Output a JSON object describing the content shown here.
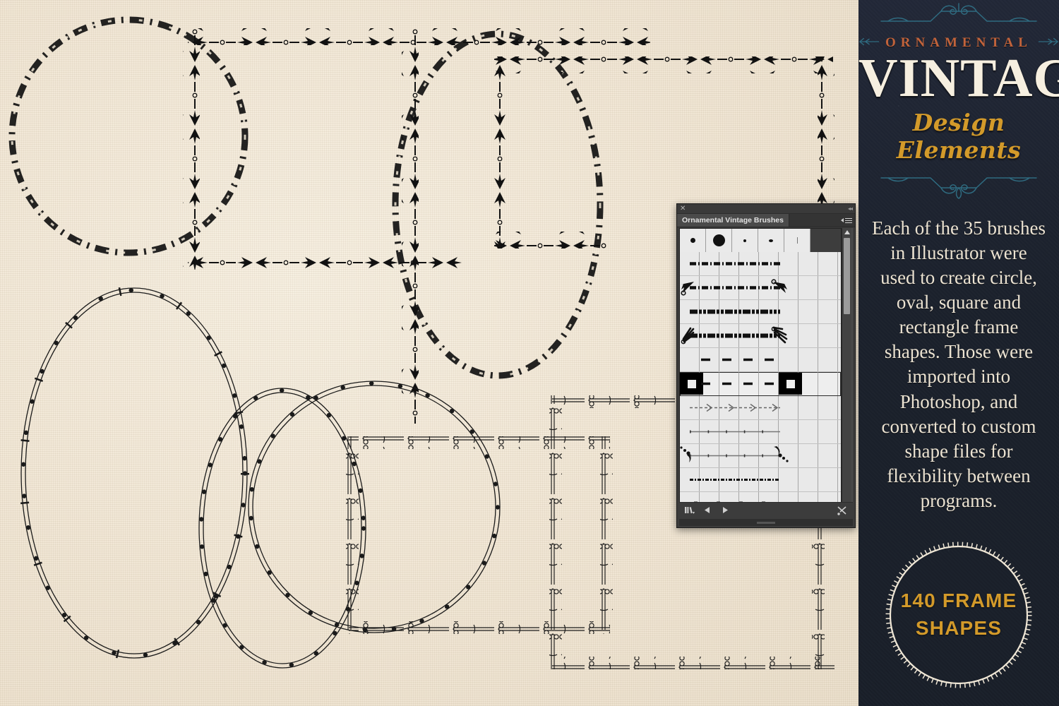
{
  "canvas": {
    "background_color": "#f1e7d6",
    "description": "Textured cream canvas with ornamental vintage frame shapes"
  },
  "brush_panel": {
    "title": "Ornamental Vintage Brushes",
    "close_label": "✕",
    "collapse_label": "◂◂",
    "menu_label": "≡",
    "background_color": "#3c3c3c",
    "brush_tips": [
      {
        "name": "hard-round-small",
        "size": 7
      },
      {
        "name": "hard-round-large",
        "size": 17
      },
      {
        "name": "hard-round-tiny",
        "size": 4
      },
      {
        "name": "oval-tiny",
        "size": 5
      },
      {
        "name": "thin-line",
        "size": 2
      }
    ],
    "brushes": [
      {
        "name": "ornament-pattern-brush-1",
        "style": "beads-leaf",
        "selected": false,
        "endcaps": false
      },
      {
        "name": "ornament-art-brush-1",
        "style": "beads-leaf",
        "selected": false,
        "endcaps": true,
        "cap": "arrow-leaf"
      },
      {
        "name": "ornament-pattern-brush-2",
        "style": "diamond-block",
        "selected": false,
        "endcaps": false
      },
      {
        "name": "ornament-art-brush-2",
        "style": "diamond-block",
        "selected": false,
        "endcaps": true,
        "cap": "starburst"
      },
      {
        "name": "ornament-pattern-brush-3",
        "style": "dash-dot",
        "selected": false,
        "endcaps": false
      },
      {
        "name": "ornament-art-brush-3",
        "style": "dash-dot",
        "selected": true,
        "endcaps": true,
        "cap": "square-block"
      },
      {
        "name": "ornament-pattern-brush-4",
        "style": "arrow-chevron",
        "selected": false,
        "endcaps": false
      },
      {
        "name": "ornament-pattern-brush-5",
        "style": "fine-bead",
        "selected": false,
        "endcaps": false
      },
      {
        "name": "ornament-art-brush-4",
        "style": "fine-bead",
        "selected": false,
        "endcaps": true,
        "cap": "dotted-tail"
      },
      {
        "name": "ornament-pattern-brush-6",
        "style": "dense-dash",
        "selected": false,
        "endcaps": false
      },
      {
        "name": "ornament-pattern-brush-7",
        "style": "rough-speckle",
        "selected": false,
        "endcaps": false
      },
      {
        "name": "ornament-pattern-brush-8",
        "style": "thin-speckle",
        "selected": false,
        "endcaps": false
      },
      {
        "name": "ornament-art-brush-5",
        "style": "thin-speckle",
        "selected": false,
        "endcaps": true,
        "cap": "four-dots"
      }
    ],
    "footer": {
      "library_label": "◧",
      "prev_label": "◀",
      "next_label": "▶",
      "options_label": "✂"
    },
    "scrollbar": {
      "up_label": "▲",
      "down_label": "▼"
    }
  },
  "promo": {
    "kicker": "ORNAMENTAL",
    "wordmark": "VINTAGE",
    "script": "Design Elements",
    "body": "Each of the 35 brushes in Illustrator were used to create circle, oval, square and rectangle frame shapes. Those were imported into Photoshop, and converted to custom shape files for flexibility between programs.",
    "badge_line1": "140 FRAME",
    "badge_line2": "SHAPES",
    "colors": {
      "background": "#1d232e",
      "kicker": "#c1633b",
      "wordmark": "#f6efe0",
      "script": "#d39a2a",
      "body": "#ece3d2",
      "flourish": "#2f6b80",
      "badge": "#d39a2a",
      "badge_ring": "#f0e7d6"
    }
  }
}
